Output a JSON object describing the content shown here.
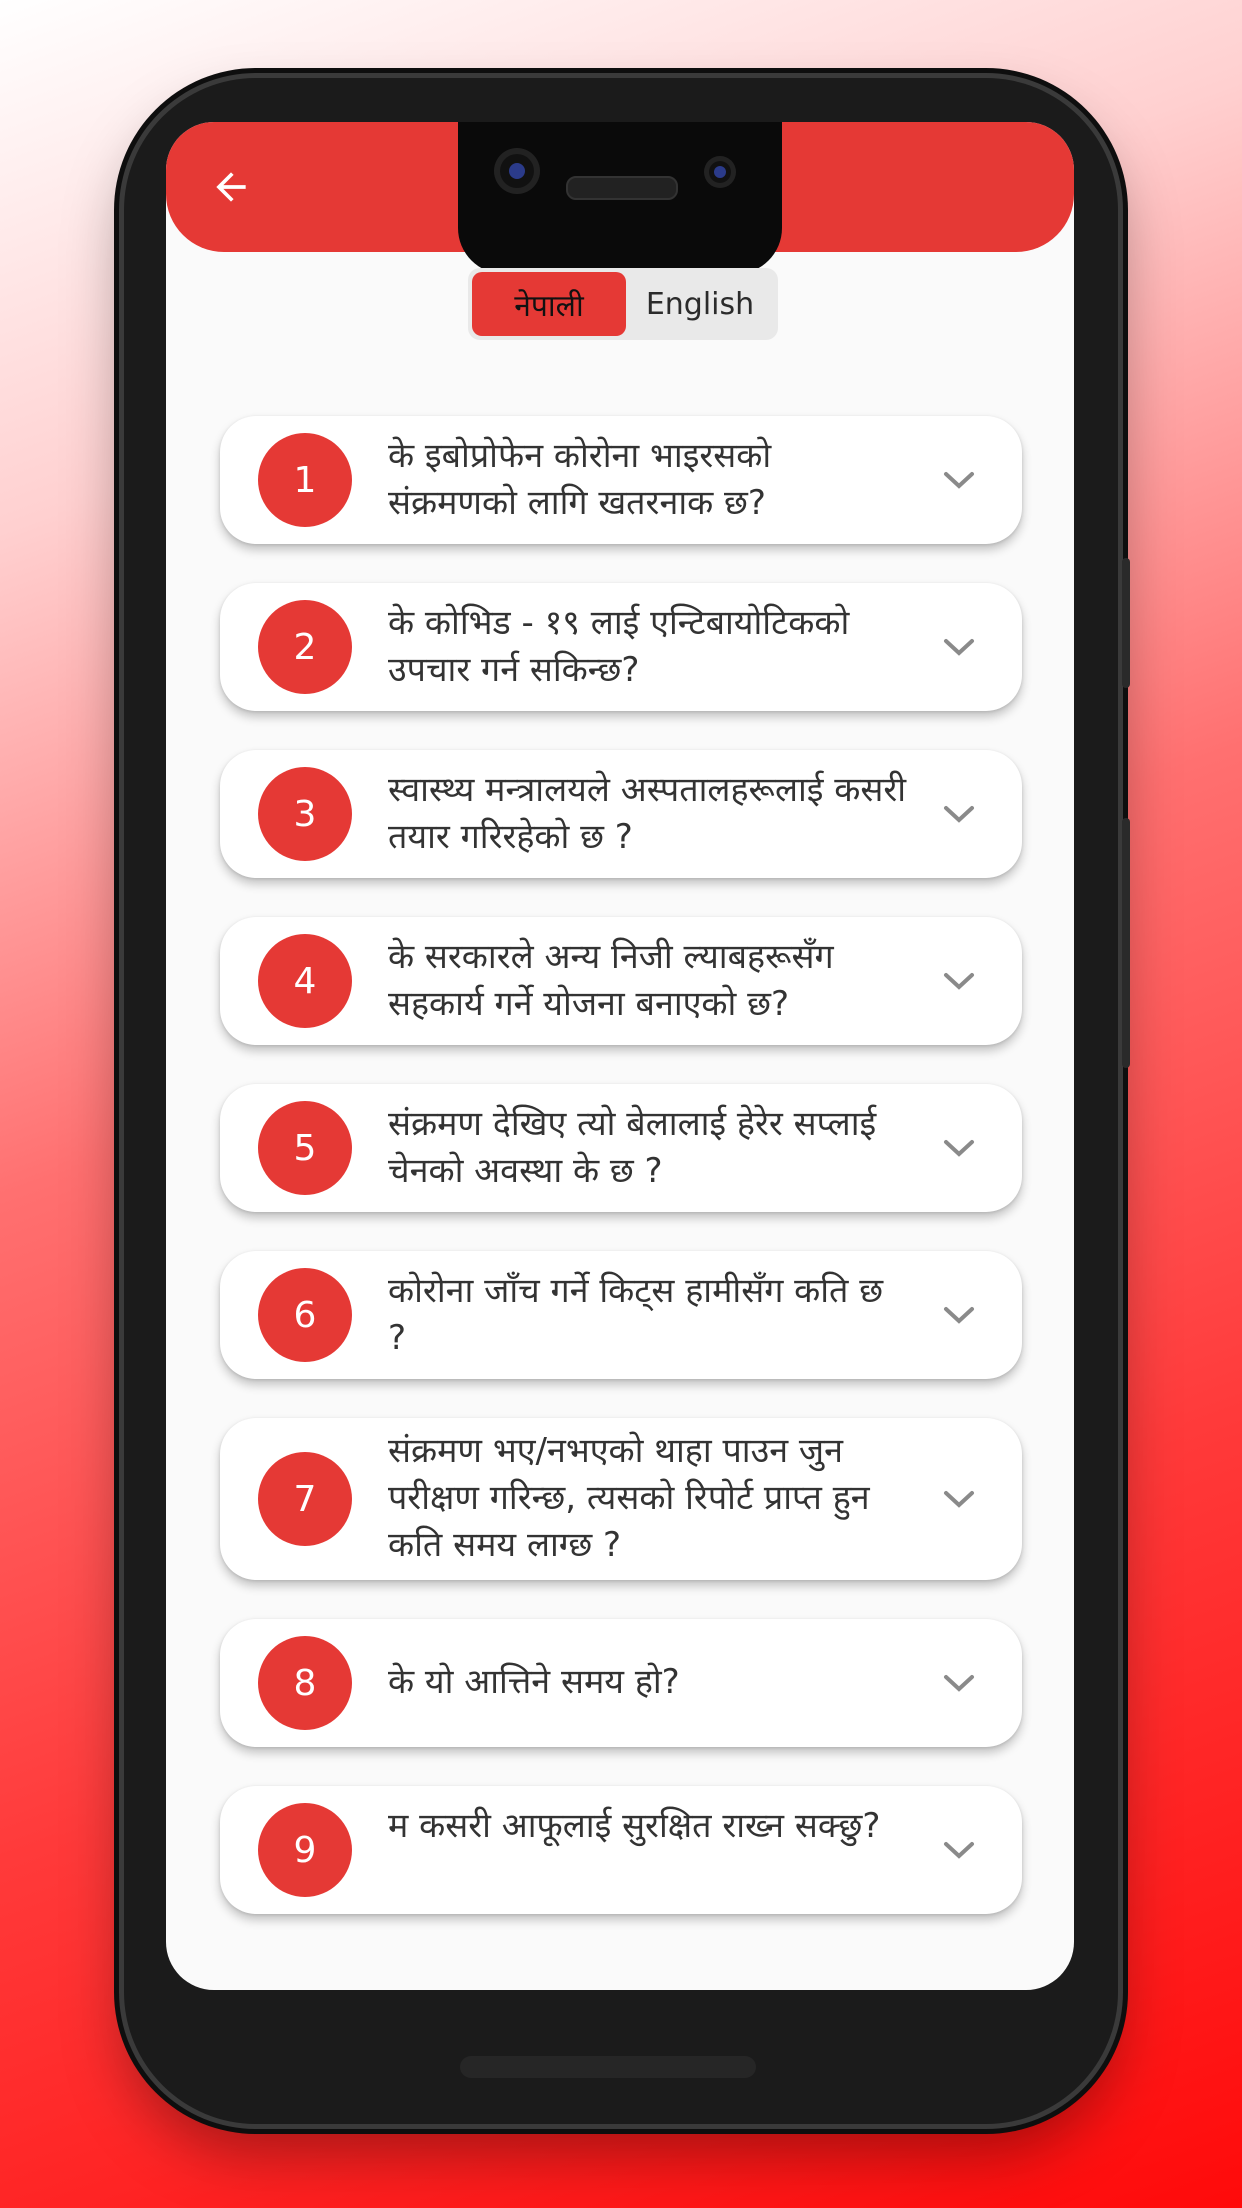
{
  "theme": {
    "accent": "#e53935",
    "background": "#fafafa"
  },
  "header": {
    "back_icon": "arrow-left-icon"
  },
  "language_toggle": {
    "options": [
      "नेपाली",
      "English"
    ],
    "selected": "नेपाली"
  },
  "faq": {
    "items": [
      {
        "number": "1",
        "question": "के इबोप्रोफेन कोरोना भाइरसको संक्रमणको लागि खतरनाक छ?"
      },
      {
        "number": "2",
        "question": "के कोभिड - १९ लाई एन्टिबायोटिकको उपचार गर्न सकिन्छ?"
      },
      {
        "number": "3",
        "question": "स्वास्थ्य मन्त्रालयले अस्पतालहरूलाई कसरी तयार गरिरहेको छ ?"
      },
      {
        "number": "4",
        "question": "के सरकारले अन्य निजी ल्याबहरूसँग सहकार्य गर्ने योजना बनाएको छ?"
      },
      {
        "number": "5",
        "question": "संक्रमण देखिए त्यो बेलालाई हेरेर सप्लाई चेनको अवस्था के छ ?"
      },
      {
        "number": "6",
        "question": "कोरोना जाँच गर्ने किट्स हामीसँग कति छ ?"
      },
      {
        "number": "7",
        "question": "संक्रमण भए/नभएको थाहा पाउन जुन परीक्षण गरिन्छ, त्यसको रिपोर्ट प्राप्त हुन कति समय लाग्छ ?"
      },
      {
        "number": "8",
        "question": "के यो आत्तिने समय हो?"
      },
      {
        "number": "9",
        "question": "म कसरी आफूलाई सुरक्षित राख्न सक्छु?"
      }
    ],
    "expand_icon": "chevron-down-icon"
  }
}
